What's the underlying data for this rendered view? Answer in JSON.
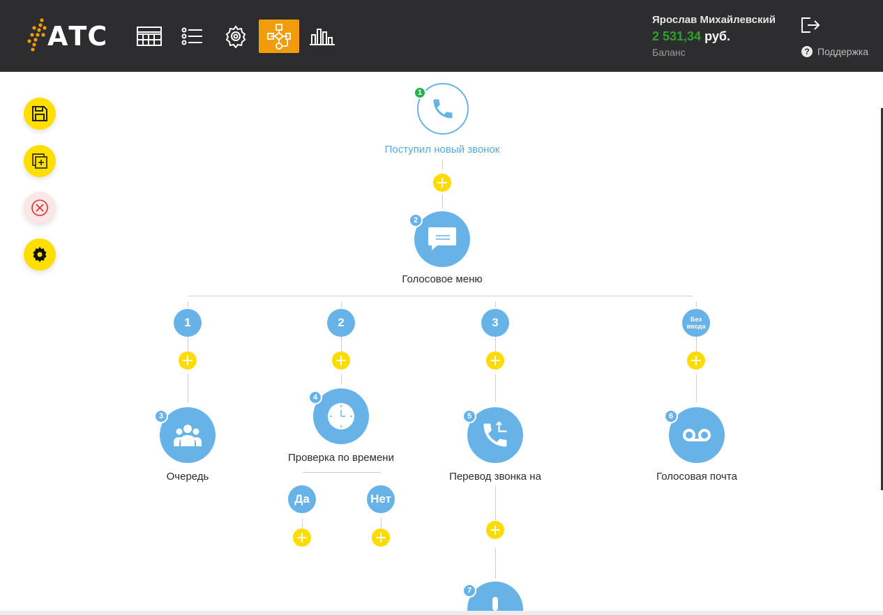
{
  "app": {
    "logo_text": "АТС"
  },
  "header": {
    "nav": [
      {
        "name": "nav-table",
        "icon": "table-icon",
        "active": false
      },
      {
        "name": "nav-list",
        "icon": "list-icon",
        "active": false
      },
      {
        "name": "nav-settings",
        "icon": "gear-icon",
        "active": false
      },
      {
        "name": "nav-scheme",
        "icon": "flow-scheme-icon",
        "active": true
      },
      {
        "name": "nav-stats",
        "icon": "bar-chart-icon",
        "active": false
      }
    ],
    "user_name": "Ярослав Михайлевский",
    "balance_amount": "2 531,34",
    "balance_currency": "руб.",
    "balance_label": "Баланс",
    "support_label": "Поддержка"
  },
  "tools": [
    {
      "name": "save-button",
      "icon": "save-icon"
    },
    {
      "name": "add-copy-button",
      "icon": "copy-plus-icon"
    },
    {
      "name": "delete-button",
      "icon": "close-circle-icon"
    },
    {
      "name": "settings-button",
      "icon": "gear-icon"
    }
  ],
  "flow": {
    "start": {
      "badge": "1",
      "label": "Поступил новый звонок"
    },
    "ivr": {
      "badge": "2",
      "label": "Голосовое меню"
    },
    "branches": [
      {
        "key": "1"
      },
      {
        "key": "2"
      },
      {
        "key": "3"
      },
      {
        "key": "Без ввода"
      }
    ],
    "queue": {
      "badge": "3",
      "label": "Очередь"
    },
    "time_check": {
      "badge": "4",
      "label": "Проверка по времени",
      "yes": "Да",
      "no": "Нет"
    },
    "transfer": {
      "badge": "5",
      "label": "Перевод звонка на"
    },
    "voicemail": {
      "badge": "6",
      "label": "Голосовая почта"
    },
    "next": {
      "badge": "7"
    }
  },
  "colors": {
    "header_bg": "#2d2d2f",
    "accent_orange": "#f29c0b",
    "node_blue": "#67b3e8",
    "plus_yellow": "#ffdb00",
    "balance_green": "#2aa32a"
  }
}
